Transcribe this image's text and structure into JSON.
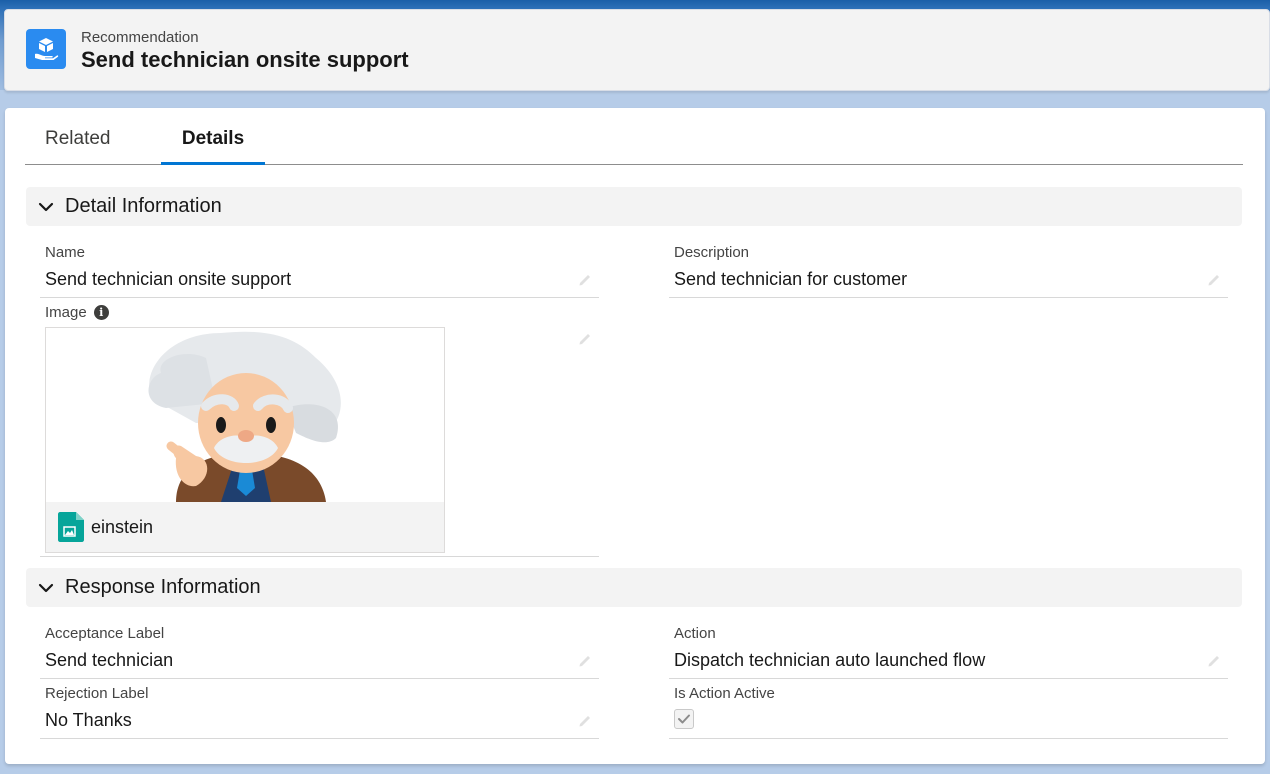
{
  "header": {
    "object_name": "Recommendation",
    "record_title": "Send technician onsite support"
  },
  "tabs": [
    {
      "label": "Related",
      "active": false
    },
    {
      "label": "Details",
      "active": true
    }
  ],
  "sections": {
    "detail": {
      "title": "Detail Information",
      "name_label": "Name",
      "name_value": "Send technician onsite support",
      "description_label": "Description",
      "description_value": "Send technician for customer",
      "image_label": "Image",
      "image_file_name": "einstein"
    },
    "response": {
      "title": "Response Information",
      "acceptance_label_label": "Acceptance Label",
      "acceptance_label_value": "Send technician",
      "action_label": "Action",
      "action_value": "Dispatch technician auto launched flow",
      "rejection_label_label": "Rejection Label",
      "rejection_label_value": "No Thanks",
      "is_action_active_label": "Is Action Active",
      "is_action_active": true
    }
  },
  "colors": {
    "brand_blue": "#0176d3",
    "record_icon": "#2a8bf0",
    "file_icon": "#06a59a"
  },
  "icons": {
    "record": "recommendation-icon",
    "chevron": "chevron-down-icon",
    "edit": "pencil-icon",
    "info": "info-icon",
    "file": "image-file-icon",
    "check": "checkmark-icon"
  }
}
